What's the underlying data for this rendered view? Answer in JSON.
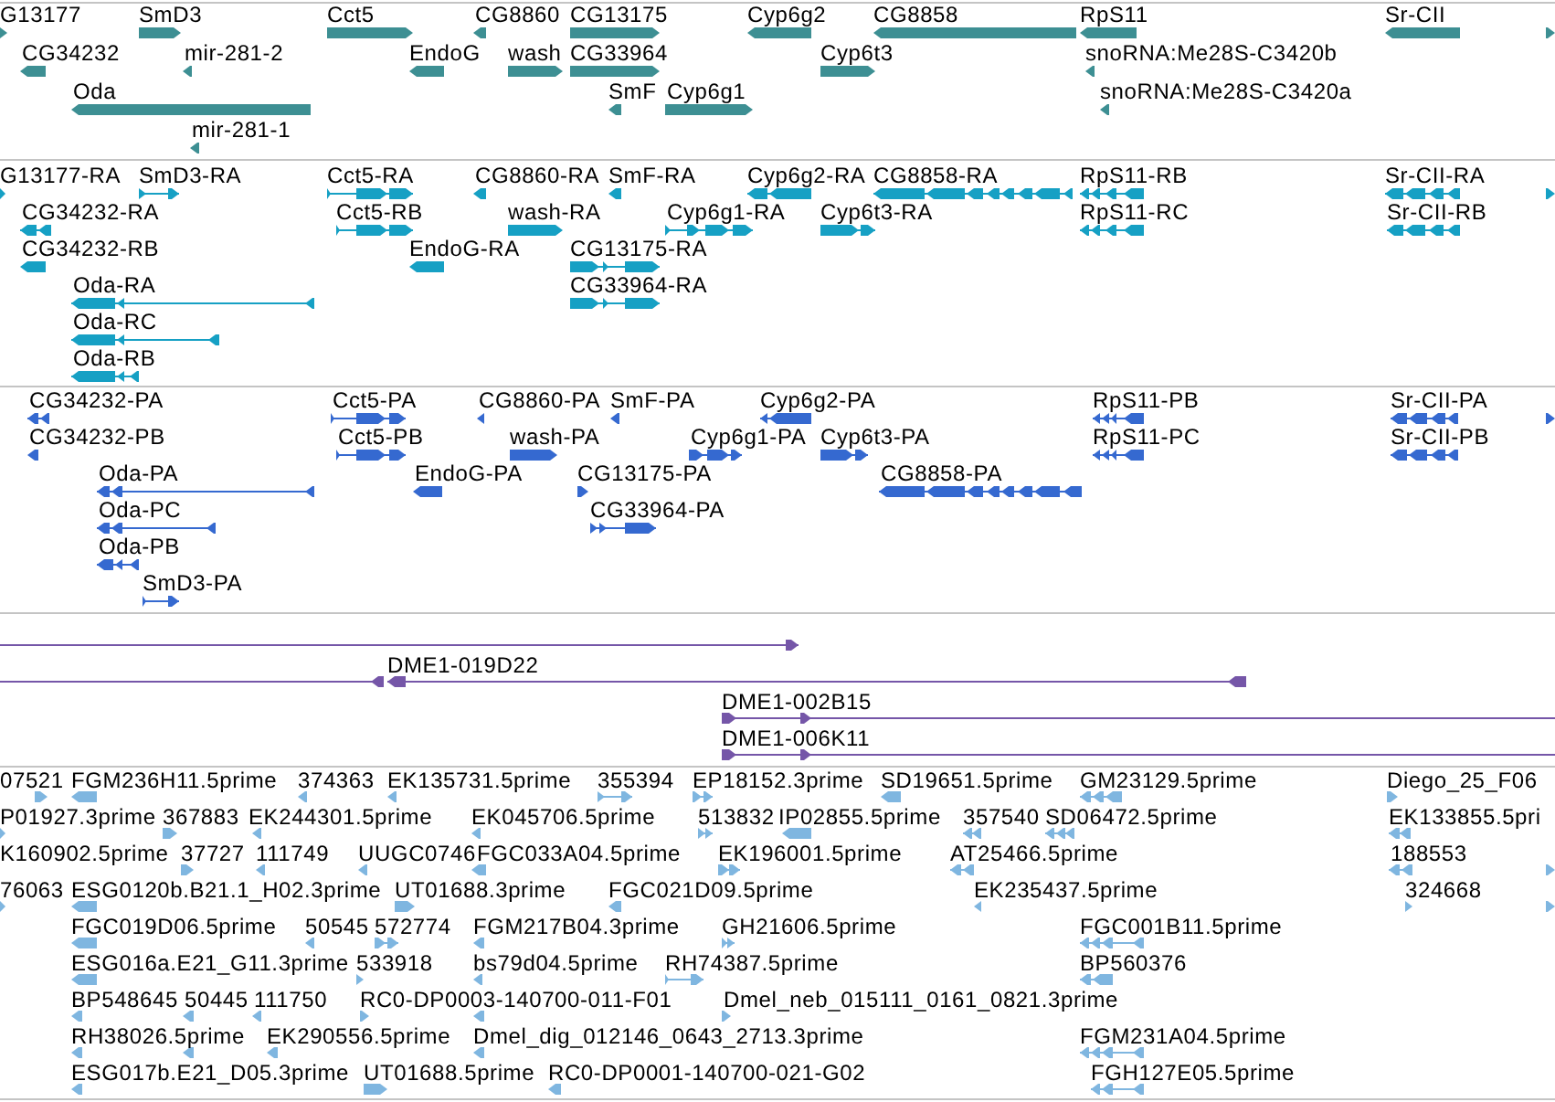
{
  "tracks": [
    {
      "kind": "gene",
      "features": [
        {
          "label": "G13177"
        },
        {
          "label": "SmD3"
        },
        {
          "label": "Cct5"
        },
        {
          "label": "CG8860"
        },
        {
          "label": "CG13175"
        },
        {
          "label": "Cyp6g2"
        },
        {
          "label": "CG8858"
        },
        {
          "label": "RpS11"
        },
        {
          "label": "Sr-CII"
        },
        {
          "label": "CG34232"
        },
        {
          "label": "mir-281-2"
        },
        {
          "label": "EndoG"
        },
        {
          "label": "wash"
        },
        {
          "label": "CG33964"
        },
        {
          "label": "Cyp6t3"
        },
        {
          "label": "snoRNA:Me28S-C3420b"
        },
        {
          "label": "Oda"
        },
        {
          "label": "SmF"
        },
        {
          "label": "Cyp6g1"
        },
        {
          "label": "snoRNA:Me28S-C3420a"
        },
        {
          "label": "mir-281-1"
        }
      ]
    },
    {
      "kind": "mrna",
      "features": [
        {
          "label": "G13177-RA"
        },
        {
          "label": "SmD3-RA"
        },
        {
          "label": "Cct5-RA"
        },
        {
          "label": "CG8860-RA"
        },
        {
          "label": "SmF-RA"
        },
        {
          "label": "Cyp6g2-RA"
        },
        {
          "label": "CG8858-RA"
        },
        {
          "label": "RpS11-RB"
        },
        {
          "label": "Sr-CII-RA"
        },
        {
          "label": "CG34232-RA"
        },
        {
          "label": "Cct5-RB"
        },
        {
          "label": "wash-RA"
        },
        {
          "label": "Cyp6g1-RA"
        },
        {
          "label": "Cyp6t3-RA"
        },
        {
          "label": "RpS11-RC"
        },
        {
          "label": "Sr-CII-RB"
        },
        {
          "label": "CG34232-RB"
        },
        {
          "label": "EndoG-RA"
        },
        {
          "label": "CG13175-RA"
        },
        {
          "label": "Oda-RA"
        },
        {
          "label": "CG33964-RA"
        },
        {
          "label": "Oda-RC"
        },
        {
          "label": "Oda-RB"
        }
      ]
    },
    {
      "kind": "protein",
      "features": [
        {
          "label": "CG34232-PA"
        },
        {
          "label": "Cct5-PA"
        },
        {
          "label": "CG8860-PA"
        },
        {
          "label": "SmF-PA"
        },
        {
          "label": "Cyp6g2-PA"
        },
        {
          "label": "RpS11-PB"
        },
        {
          "label": "Sr-CII-PA"
        },
        {
          "label": "CG34232-PB"
        },
        {
          "label": "Cct5-PB"
        },
        {
          "label": "wash-PA"
        },
        {
          "label": "Cyp6g1-PA"
        },
        {
          "label": "Cyp6t3-PA"
        },
        {
          "label": "RpS11-PC"
        },
        {
          "label": "Sr-CII-PB"
        },
        {
          "label": "Oda-PA"
        },
        {
          "label": "EndoG-PA"
        },
        {
          "label": "CG13175-PA"
        },
        {
          "label": "CG8858-PA"
        },
        {
          "label": "Oda-PC"
        },
        {
          "label": "CG33964-PA"
        },
        {
          "label": "Oda-PB"
        },
        {
          "label": "SmD3-PA"
        }
      ]
    },
    {
      "kind": "clone",
      "features": [
        {
          "label": "DME1-019D22"
        },
        {
          "label": "DME1-002B15"
        },
        {
          "label": "DME1-006K11"
        }
      ]
    },
    {
      "kind": "est",
      "features": [
        {
          "label": "07521"
        },
        {
          "label": "FGM236H11.5prime"
        },
        {
          "label": "374363"
        },
        {
          "label": "EK135731.5prime"
        },
        {
          "label": "355394"
        },
        {
          "label": "EP18152.3prime"
        },
        {
          "label": "SD19651.5prime"
        },
        {
          "label": "GM23129.5prime"
        },
        {
          "label": "Diego_25_F06"
        },
        {
          "label": "P01927.3prime"
        },
        {
          "label": "367883"
        },
        {
          "label": "EK244301.5prime"
        },
        {
          "label": "EK045706.5prime"
        },
        {
          "label": "513832"
        },
        {
          "label": "IP02855.5prime"
        },
        {
          "label": "357540"
        },
        {
          "label": "SD06472.5prime"
        },
        {
          "label": "EK133855.5pri"
        },
        {
          "label": "K160902.5prime"
        },
        {
          "label": "37727"
        },
        {
          "label": "111749"
        },
        {
          "label": "UUGC0746"
        },
        {
          "label": "FGC033A04.5prime"
        },
        {
          "label": "EK196001.5prime"
        },
        {
          "label": "AT25466.5prime"
        },
        {
          "label": "188553"
        },
        {
          "label": "76063"
        },
        {
          "label": "ESG0120b.B21.1_H02.3prime"
        },
        {
          "label": "UT01688.3prime"
        },
        {
          "label": "FGC021D09.5prime"
        },
        {
          "label": "EK235437.5prime"
        },
        {
          "label": "324668"
        },
        {
          "label": "FGC019D06.5prime"
        },
        {
          "label": "50545"
        },
        {
          "label": "572774"
        },
        {
          "label": "FGM217B04.3prime"
        },
        {
          "label": "GH21606.5prime"
        },
        {
          "label": "FGC001B11.5prime"
        },
        {
          "label": "ESG016a.E21_G11.3prime"
        },
        {
          "label": "533918"
        },
        {
          "label": "bs79d04.5prime"
        },
        {
          "label": "RH74387.5prime"
        },
        {
          "label": "BP560376"
        },
        {
          "label": "BP548645"
        },
        {
          "label": "50445"
        },
        {
          "label": "111750"
        },
        {
          "label": "RC0-DP0003-140700-011-F01"
        },
        {
          "label": "Dmel_neb_015111_0161_0821.3prime"
        },
        {
          "label": "RH38026.5prime"
        },
        {
          "label": "EK290556.5prime"
        },
        {
          "label": "Dmel_dig_012146_0643_2713.3prime"
        },
        {
          "label": "FGM231A04.5prime"
        },
        {
          "label": "ESG017b.E21_D05.3prime"
        },
        {
          "label": "UT01688.5prime"
        },
        {
          "label": "RC0-DP0001-140700-021-G02"
        },
        {
          "label": "FGH127E05.5prime"
        }
      ]
    }
  ]
}
